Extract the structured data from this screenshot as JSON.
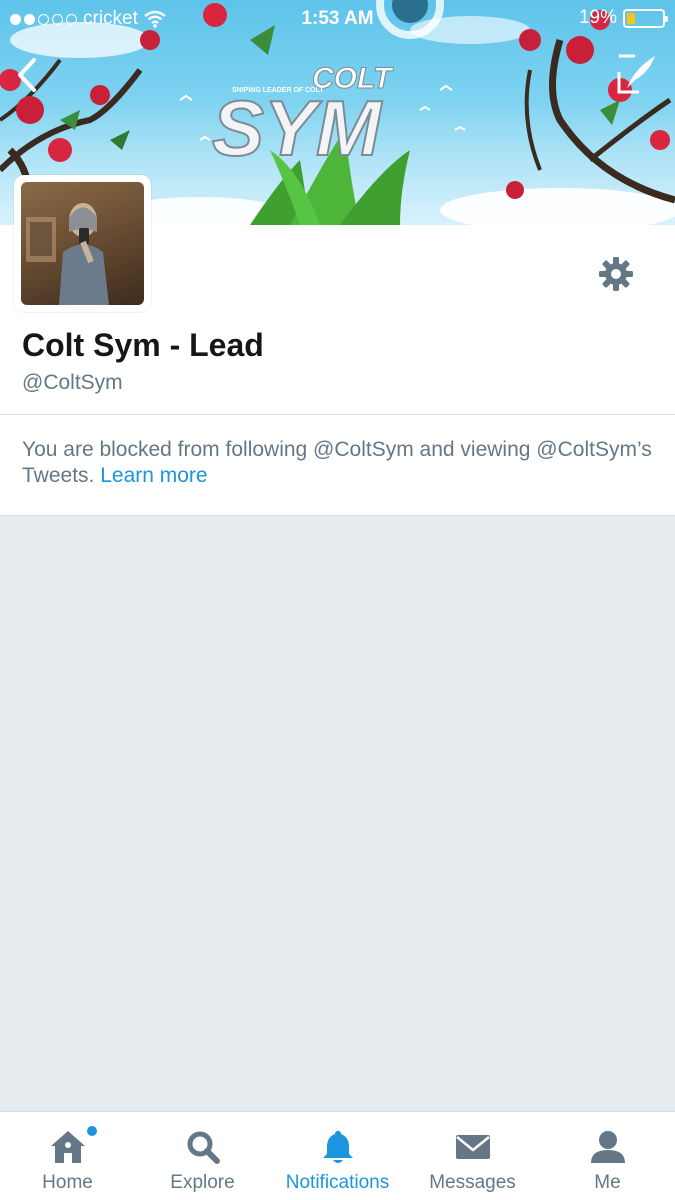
{
  "status_bar": {
    "carrier": "cricket",
    "time": "1:53 AM",
    "battery_percent": "19%",
    "battery_level": 0.19,
    "signal_bars_filled": 2,
    "signal_bars_total": 5
  },
  "banner": {
    "title_small": "COLT",
    "title_large": "SYM",
    "tagline": "SNIPING LEADER OF COLT"
  },
  "profile": {
    "display_name": "Colt Sym - Lead",
    "handle": "@ColtSym"
  },
  "notice": {
    "text": "You are blocked from following @ColtSym and viewing @ColtSym’s Tweets.",
    "link": "Learn more"
  },
  "tabs": [
    {
      "label": "Home",
      "icon": "home-icon"
    },
    {
      "label": "Explore",
      "icon": "search-icon"
    },
    {
      "label": "Notifications",
      "icon": "bell-icon"
    },
    {
      "label": "Messages",
      "icon": "envelope-icon"
    },
    {
      "label": "Me",
      "icon": "person-icon"
    }
  ],
  "colors": {
    "accent": "#1b95e0",
    "muted": "#657786",
    "text": "#14171a",
    "background": "#e6ecf0"
  }
}
